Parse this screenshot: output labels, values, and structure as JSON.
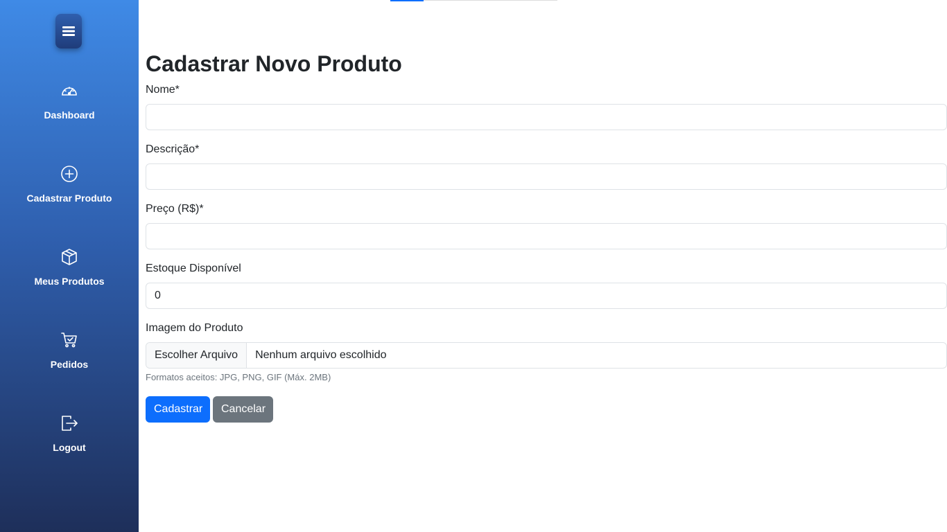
{
  "sidebar": {
    "items": [
      {
        "label": "Dashboard",
        "icon": "speedometer-icon"
      },
      {
        "label": "Cadastrar Produto",
        "icon": "plus-circle-icon"
      },
      {
        "label": "Meus Produtos",
        "icon": "box-icon"
      },
      {
        "label": "Pedidos",
        "icon": "cart-check-icon"
      },
      {
        "label": "Logout",
        "icon": "logout-icon"
      }
    ]
  },
  "form": {
    "title": "Cadastrar Novo Produto",
    "fields": {
      "nome": {
        "label": "Nome*",
        "value": ""
      },
      "descricao": {
        "label": "Descrição*",
        "value": ""
      },
      "preco": {
        "label": "Preço (R$)*",
        "value": ""
      },
      "estoque": {
        "label": "Estoque Disponível",
        "value": "0"
      },
      "imagem": {
        "label": "Imagem do Produto",
        "button": "Escolher Arquivo",
        "status": "Nenhum arquivo escolhido",
        "help": "Formatos aceitos: JPG, PNG, GIF (Máx. 2MB)"
      }
    },
    "submit_label": "Cadastrar",
    "cancel_label": "Cancelar"
  },
  "colors": {
    "primary": "#0d6efd",
    "secondary": "#6c757d",
    "sidebar_top": "#3f8ae6",
    "sidebar_bottom": "#1e2f5a"
  }
}
